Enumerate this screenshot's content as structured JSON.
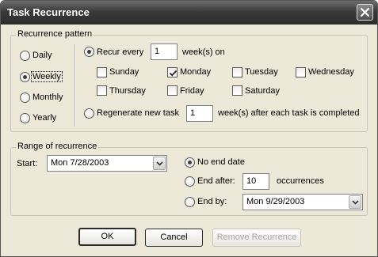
{
  "window": {
    "title": "Task Recurrence"
  },
  "pattern": {
    "legend": "Recurrence pattern",
    "types": [
      {
        "label": "Daily",
        "selected": false
      },
      {
        "label": "Weekly",
        "selected": true
      },
      {
        "label": "Monthly",
        "selected": false
      },
      {
        "label": "Yearly",
        "selected": false
      }
    ],
    "recur_every_label": "Recur every",
    "recur_every_value": "1",
    "weeks_on_label": "week(s) on",
    "days": [
      {
        "label": "Sunday",
        "checked": false
      },
      {
        "label": "Monday",
        "checked": true
      },
      {
        "label": "Tuesday",
        "checked": false
      },
      {
        "label": "Wednesday",
        "checked": false
      },
      {
        "label": "Thursday",
        "checked": false
      },
      {
        "label": "Friday",
        "checked": false
      },
      {
        "label": "Saturday",
        "checked": false
      }
    ],
    "regenerate_label": "Regenerate new task",
    "regenerate_value": "1",
    "regenerate_suffix": "week(s) after each task is completed"
  },
  "range": {
    "legend": "Range of recurrence",
    "start_label": "Start:",
    "start_value": "Mon 7/28/2003",
    "no_end_label": "No end date",
    "end_after_label": "End after:",
    "end_after_value": "10",
    "occurrences_label": "occurrences",
    "end_by_label": "End by:",
    "end_by_value": "Mon 9/29/2003"
  },
  "buttons": {
    "ok": "OK",
    "cancel": "Cancel",
    "remove": "Remove Recurrence"
  }
}
